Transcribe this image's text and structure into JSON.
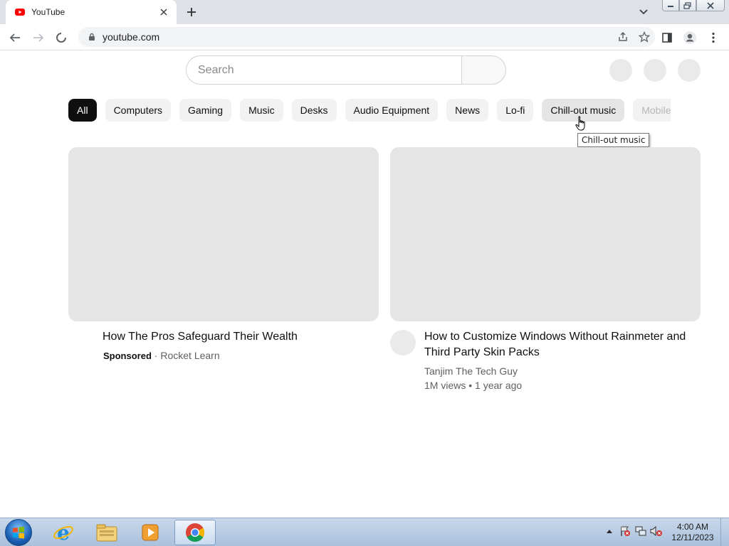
{
  "browser": {
    "tab": {
      "title": "YouTube",
      "favicon": "youtube-favicon-icon",
      "close_icon": "close-icon"
    },
    "new_tab_icon": "plus-icon",
    "tab_search_icon": "chevron-down-icon",
    "window_controls": [
      "minimize-icon",
      "restore-icon",
      "close-icon"
    ],
    "toolbar": {
      "back_icon": "back-arrow-icon",
      "forward_icon": "forward-arrow-icon",
      "stop_icon": "loading-spinner-icon",
      "url": "youtube.com",
      "omnibox_icons": [
        "share-icon",
        "star-icon",
        "side-panel-icon",
        "profile-icon",
        "more-vert-icon"
      ]
    }
  },
  "youtube": {
    "search": {
      "placeholder": "Search"
    },
    "chips": [
      {
        "label": "All",
        "state": "active"
      },
      {
        "label": "Computers",
        "state": "normal"
      },
      {
        "label": "Gaming",
        "state": "normal"
      },
      {
        "label": "Music",
        "state": "normal"
      },
      {
        "label": "Desks",
        "state": "normal"
      },
      {
        "label": "Audio Equipment",
        "state": "normal"
      },
      {
        "label": "News",
        "state": "normal"
      },
      {
        "label": "Lo-fi",
        "state": "normal"
      },
      {
        "label": "Chill-out music",
        "state": "hover"
      },
      {
        "label": "Mobile",
        "state": "faded"
      }
    ],
    "tooltip": "Chill-out music",
    "videos": [
      {
        "title": "How The Pros Safeguard Their Wealth",
        "sponsored_label": "Sponsored",
        "separator": " · ",
        "channel": "Rocket Learn"
      },
      {
        "title": "How to Customize Windows Without Rainmeter and Third Party Skin Packs",
        "channel": "Tanjim The Tech Guy",
        "stats": "1M views • 1 year ago"
      }
    ]
  },
  "taskbar": {
    "start_icon": "windows-start-icon",
    "pinned": [
      "internet-explorer-icon",
      "file-explorer-icon",
      "media-player-icon",
      "chrome-icon"
    ],
    "tray_icons": [
      "show-hidden-icons-icon",
      "action-center-icon",
      "network-icon",
      "volume-muted-icon"
    ],
    "clock": {
      "time": "4:00 AM",
      "date": "12/11/2023"
    }
  },
  "colors": {
    "tab_strip": "#dee1e6",
    "chip_active": "#0f0f0f",
    "chip": "#f2f2f2",
    "placeholder": "#e5e5e5",
    "youtube_red": "#ff0000",
    "taskbar": "#b9cce3"
  }
}
